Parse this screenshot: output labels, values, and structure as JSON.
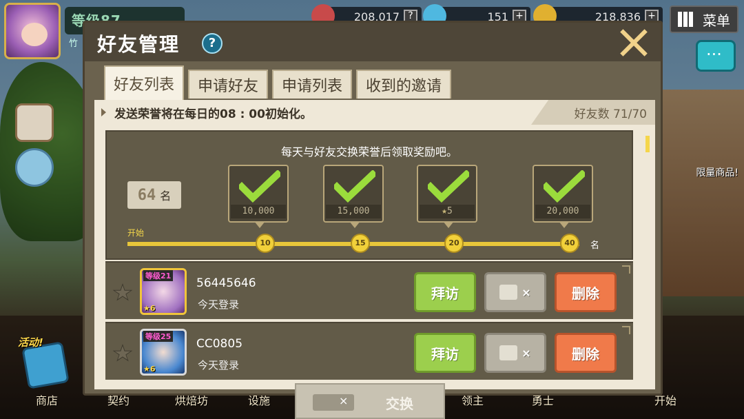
{
  "hud": {
    "level_text": "等级87",
    "sub_text": "竹",
    "resources": [
      {
        "icon": "trophy-icon",
        "value": "208,017",
        "color": "#e05050"
      },
      {
        "icon": "gem-icon",
        "value": "151",
        "color": "#5cc8e8"
      },
      {
        "icon": "coin-icon",
        "value": "218,836",
        "color": "#f0c040"
      }
    ],
    "menu_label": "菜单",
    "limited_label": "限量商品!",
    "event_label": "活动!",
    "bottom_nav": [
      "商店",
      "契约",
      "烘焙坊",
      "设施",
      "领主",
      "勇士",
      "开始"
    ]
  },
  "dialog": {
    "title": "好友管理",
    "tabs": [
      {
        "label": "好友列表",
        "active": true
      },
      {
        "label": "申请好友",
        "active": false
      },
      {
        "label": "申请列表",
        "active": false
      },
      {
        "label": "收到的邀请",
        "active": false
      }
    ],
    "notice": "发送荣誉将在每日的08 : 00初始化。",
    "friend_count": "好友数 71/70",
    "reward": {
      "title": "每天与好友交换荣誉后领取奖励吧。",
      "rank_value": "64",
      "rank_unit": "名",
      "start_label": "开始",
      "end_unit": "名",
      "milestones": [
        {
          "reward": "10,000",
          "node": "10",
          "claimed": true
        },
        {
          "reward": "15,000",
          "node": "15",
          "claimed": true
        },
        {
          "reward": "5",
          "node": "20",
          "claimed": true
        },
        {
          "reward": "20,000",
          "node": "40",
          "claimed": true
        }
      ]
    },
    "friends": [
      {
        "level": "等级21",
        "stars": "6",
        "name": "56445646",
        "status": "今天登录"
      },
      {
        "level": "等级25",
        "stars": "6",
        "name": "CC0805",
        "status": "今天登录"
      }
    ],
    "buttons": {
      "visit": "拜访",
      "send_x": "×",
      "delete": "删除"
    },
    "exchange": {
      "x": "×",
      "label": "交换"
    }
  }
}
